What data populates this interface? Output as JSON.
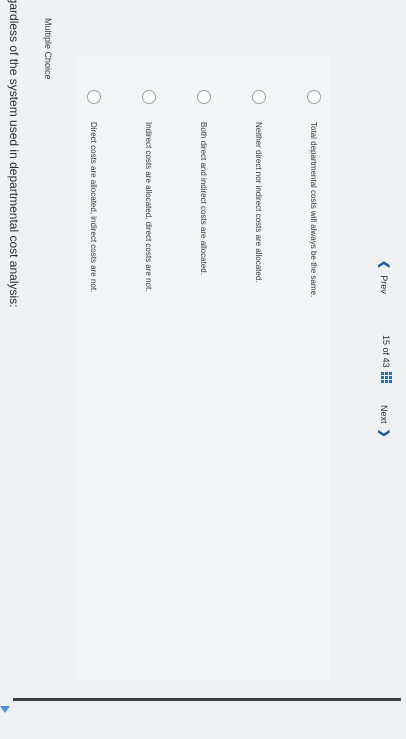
{
  "question": {
    "text": "egardless of the system used in departmental cost analysis:",
    "type_label": "Multiple Choice"
  },
  "options": [
    "Direct costs are allocated, indirect costs are not.",
    "Indirect costs are allocated, direct costs are not.",
    "Both direct and indirect costs are allocated.",
    "Neither direct nor indirect costs are allocated.",
    "Total departmental costs will always be the same."
  ],
  "navigation": {
    "prev_label": "Prev",
    "page_current": "15",
    "page_of": "of",
    "page_total": "43",
    "next_label": "Next"
  },
  "colors": {
    "accent": "#1f6fb6",
    "radio_border": "#9aa1a8",
    "background": "#eef0f1"
  },
  "icons": [
    "chevron-left-icon",
    "grid-icon",
    "chevron-right-icon"
  ]
}
